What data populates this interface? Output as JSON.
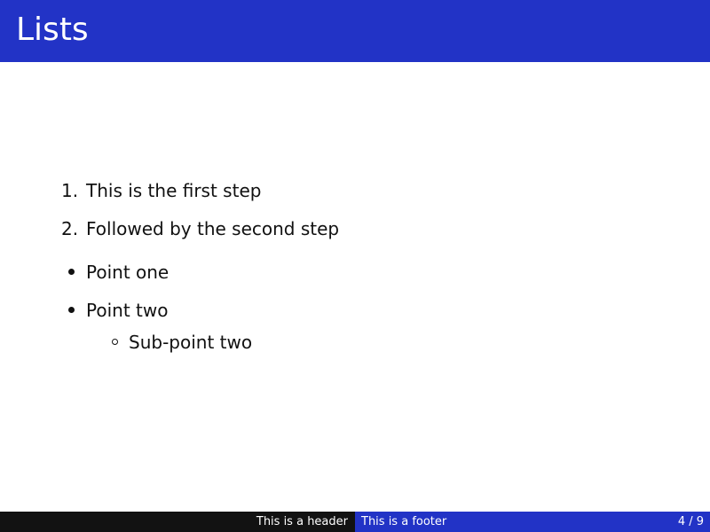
{
  "slide": {
    "title": "Lists"
  },
  "ordered_list": [
    {
      "marker": "1.",
      "text": "This is the first step"
    },
    {
      "marker": "2.",
      "text": "Followed by the second step"
    }
  ],
  "bullet_list": [
    {
      "text": "Point one"
    },
    {
      "text": "Point two",
      "sub_items": [
        {
          "text": "Sub-point two"
        }
      ]
    }
  ],
  "footer": {
    "header_text": "This is a header",
    "footer_text": "This is a footer",
    "page_number": "4 / 9"
  },
  "colors": {
    "accent": "#2233c6",
    "footer_dark": "#121212",
    "text": "#111111"
  }
}
